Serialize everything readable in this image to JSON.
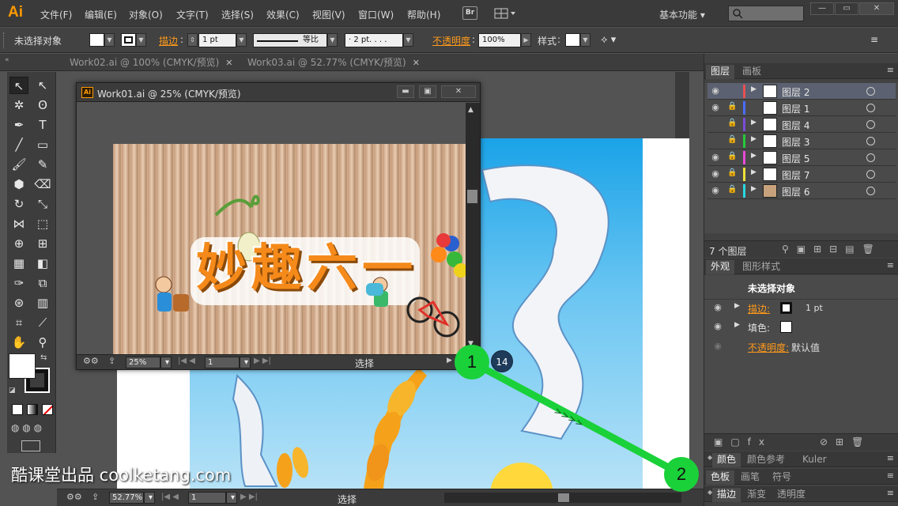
{
  "menubar": {
    "logo": "Ai",
    "items": [
      "文件(F)",
      "编辑(E)",
      "对象(O)",
      "文字(T)",
      "选择(S)",
      "效果(C)",
      "视图(V)",
      "窗口(W)",
      "帮助(H)"
    ],
    "bridge_label": "Br",
    "workspace": "基本功能",
    "workspace_arrow": "▾",
    "window_buttons": [
      "—",
      "▭",
      "✕"
    ]
  },
  "controlbar": {
    "selection_status": "未选择对象",
    "stroke_label": "描边",
    "stroke_weight": "1 pt",
    "stroke_profile": "等比",
    "brush_def": "· 2 pt. . . .",
    "opacity_label": "不透明度",
    "opacity_value": "100%",
    "style_label": "样式"
  },
  "tabs": [
    {
      "label": "Work02.ai @ 100% (CMYK/预览)",
      "close": "✕"
    },
    {
      "label": "Work03.ai @ 52.77% (CMYK/预览)",
      "close": "✕"
    }
  ],
  "float_window": {
    "icon": "Ai",
    "title": "Work01.ai @ 25% (CMYK/预览)",
    "buttons": [
      "▬",
      "▣",
      "✕"
    ],
    "zoom": "25%",
    "artboard_num": "1",
    "status": "选择",
    "art_title": "妙趣六一"
  },
  "bottombar": {
    "zoom": "52.77%",
    "artboard_num": "1",
    "status": "选择"
  },
  "layers_panel": {
    "tabs": [
      "图层",
      "画板"
    ],
    "count": "7 个图层",
    "layers": [
      {
        "name": "图层 2",
        "visible": true,
        "locked": false,
        "color": "#e85050",
        "selected": true
      },
      {
        "name": "图层 1",
        "visible": true,
        "locked": true,
        "color": "#4a6cff",
        "selected": false
      },
      {
        "name": "图层 4",
        "visible": false,
        "locked": true,
        "color": "#7a4cd8",
        "selected": false
      },
      {
        "name": "图层 3",
        "visible": false,
        "locked": true,
        "color": "#26c93a",
        "selected": false
      },
      {
        "name": "图层 5",
        "visible": true,
        "locked": true,
        "color": "#e84ad8",
        "selected": false
      },
      {
        "name": "图层 7",
        "visible": true,
        "locked": true,
        "color": "#f0e23a",
        "selected": false
      },
      {
        "name": "图层 6",
        "visible": true,
        "locked": true,
        "color": "#2ad8e0",
        "selected": false
      }
    ]
  },
  "appearance_panel": {
    "tabs": [
      "外观",
      "图形样式"
    ],
    "heading": "未选择对象",
    "stroke_label": "描边:",
    "stroke_value": "1 pt",
    "fill_label": "填色:",
    "opacity_label": "不透明度:",
    "opacity_value": "默认值"
  },
  "bottom_panels": {
    "row1": [
      "颜色",
      "颜色参考",
      "Kuler"
    ],
    "row2": [
      "色板",
      "画笔",
      "符号"
    ],
    "row3": [
      "描边",
      "渐变",
      "透明度"
    ]
  },
  "watermark": "酷课堂出品 coolketang.com",
  "annotations": {
    "marker1": "1",
    "marker2": "2",
    "badge": "14"
  },
  "colors": {
    "accent": "#ff9a00",
    "highlight": "#1ad13a",
    "panel": "#424242"
  }
}
